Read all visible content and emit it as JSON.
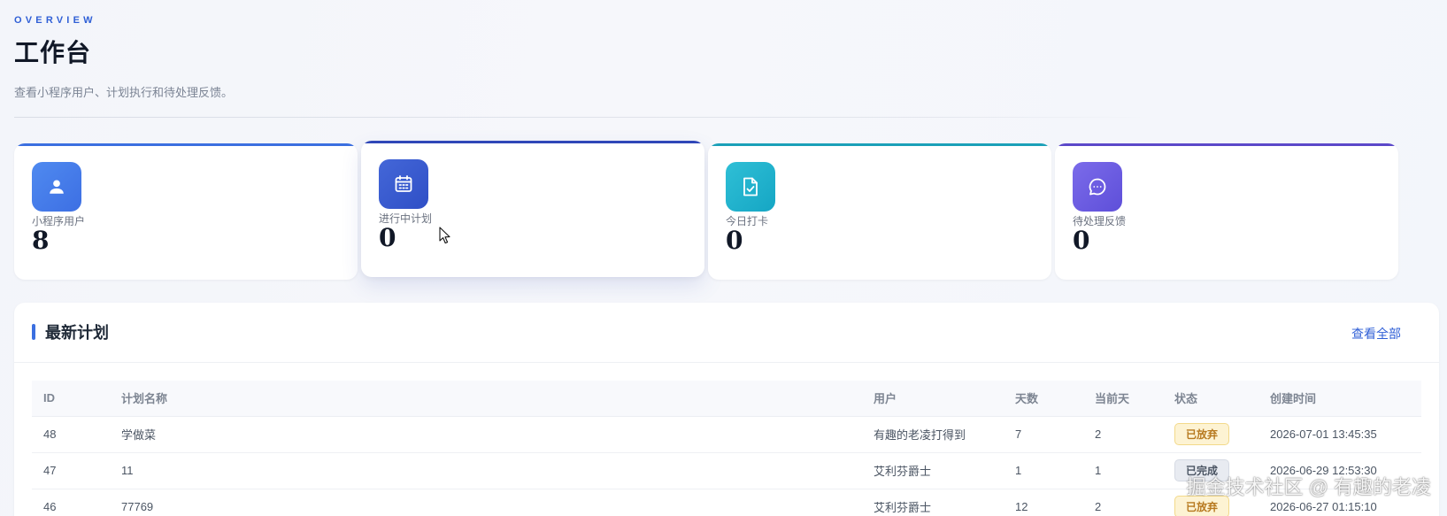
{
  "header": {
    "eyebrow": "OVERVIEW",
    "title": "工作台",
    "subtitle": "查看小程序用户、计划执行和待处理反馈。"
  },
  "stats": [
    {
      "label": "小程序用户",
      "value": "8",
      "icon": "user-icon",
      "accent": "#3b6fe0",
      "icon_from": "#4f8af0",
      "icon_to": "#3d6fe3"
    },
    {
      "label": "进行中计划",
      "value": "0",
      "icon": "calendar-icon",
      "accent": "#2f47b8",
      "icon_from": "#4467d8",
      "icon_to": "#2f4fc6"
    },
    {
      "label": "今日打卡",
      "value": "0",
      "icon": "document-check-icon",
      "accent": "#1aa0b8",
      "icon_from": "#2fbfd6",
      "icon_to": "#15a6c4"
    },
    {
      "label": "待处理反馈",
      "value": "0",
      "icon": "chat-bubble-icon",
      "accent": "#5b48c9",
      "icon_from": "#7b6bea",
      "icon_to": "#5e4fd9"
    }
  ],
  "plans_panel": {
    "title": "最新计划",
    "view_all": "查看全部",
    "columns": [
      "ID",
      "计划名称",
      "用户",
      "天数",
      "当前天",
      "状态",
      "创建时间"
    ],
    "rows": [
      {
        "id": "48",
        "name": "学做菜",
        "user": "有趣的老凌打得到",
        "days": "7",
        "current_day": "2",
        "status": "已放弃",
        "status_type": "abandoned",
        "created": "2026-07-01 13:45:35"
      },
      {
        "id": "47",
        "name": "11",
        "user": "艾利芬爵士",
        "days": "1",
        "current_day": "1",
        "status": "已完成",
        "status_type": "done",
        "created": "2026-06-29 12:53:30"
      },
      {
        "id": "46",
        "name": "77769",
        "user": "艾利芬爵士",
        "days": "12",
        "current_day": "2",
        "status": "已放弃",
        "status_type": "abandoned",
        "created": "2026-06-27 01:15:10"
      }
    ]
  },
  "status_colors": {
    "abandoned": {
      "bg": "#fdf3d3",
      "border": "#f3d98a",
      "text": "#b7791f"
    },
    "done": {
      "bg": "#e8ebf1",
      "border": "#d5dae3",
      "text": "#4b5563"
    }
  },
  "watermark": "掘金技术社区 @ 有趣的老凌"
}
